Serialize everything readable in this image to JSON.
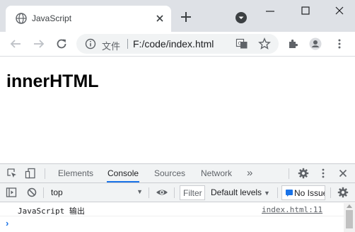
{
  "browser": {
    "tab": {
      "title": "JavaScript"
    },
    "address": {
      "scheme_label": "文件",
      "url": "F:/code/index.html"
    }
  },
  "page": {
    "heading": "innerHTML"
  },
  "devtools": {
    "tabs": [
      {
        "label": "Elements",
        "active": false
      },
      {
        "label": "Console",
        "active": true
      },
      {
        "label": "Sources",
        "active": false
      },
      {
        "label": "Network",
        "active": false
      }
    ],
    "more_tabs_label": "»",
    "console_toolbar": {
      "context": "top",
      "filter_placeholder": "Filter",
      "levels_label": "Default levels",
      "issues_label": "No Issues"
    },
    "log": [
      {
        "message": "JavaScript 输出",
        "source": "index.html:11"
      }
    ],
    "prompt_symbol": "›"
  },
  "colors": {
    "accent": "#1a73e8",
    "tabstrip_bg": "#dee1e6",
    "devtools_bar_bg": "#f1f3f4"
  }
}
